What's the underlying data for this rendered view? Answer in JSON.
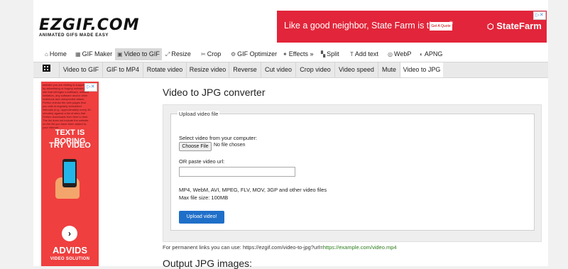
{
  "logo": {
    "main": "EZGIF.COM",
    "tagline": "ANIMATED GIFS MADE EASY"
  },
  "top_ad": {
    "slogan": "Like a good neighbor, State Farm is there.",
    "trademark": "®",
    "button": "Get A Quote",
    "brand": "StateFarm",
    "brand_icon": "state-farm-logo",
    "adchoice": "▷✕",
    "bg": "#e2253a"
  },
  "nav_main": [
    {
      "label": "Home",
      "icon": "⌂"
    },
    {
      "label": "GIF Maker",
      "icon": "▦"
    },
    {
      "label": "Video to GIF",
      "icon": "▣"
    },
    {
      "label": "Resize",
      "icon": "⤢"
    },
    {
      "label": "Crop",
      "icon": "✂"
    },
    {
      "label": "GIF Optimizer",
      "icon": "⚙"
    },
    {
      "label": "Effects »",
      "icon": "✦"
    },
    {
      "label": "Split",
      "icon": "▚"
    },
    {
      "label": "Add text",
      "icon": "T"
    },
    {
      "label": "WebP",
      "icon": "◎"
    },
    {
      "label": "APNG",
      "icon": "◐"
    }
  ],
  "nav_sub": [
    "Video to GIF",
    "GIF to MP4",
    "Rotate video",
    "Resize video",
    "Reverse",
    "Cut video",
    "Crop video",
    "Video speed",
    "Mute",
    "Video to JPG"
  ],
  "side_ad": {
    "blurred_text": "website you are visiting is supported by advertising or forgery website) or a site that infringes a software, without limitation, any software and/or other malicious and unexpected attack, Firefox checks the web pages that you visit at regularly scheduled intervals (e.g., approximately every 30 minutes) against a list of sites that Firefox downloads from time to time. The list does not include the website on the list you have been added to, your internet...",
    "line1": "TEXT IS BORING",
    "line2": "TRY VIDEO",
    "arrow": "›",
    "brand": "ADVIDS",
    "sub": "VIDEO SOLUTION",
    "adchoice": "▷✕"
  },
  "page": {
    "title": "Video to JPG converter",
    "legend": "Upload video file",
    "select_label": "Select video from your computer:",
    "choose_button": "Choose File",
    "no_file": "No file chosen",
    "paste_label": "OR paste video url:",
    "url_value": "",
    "formats": "MP4, WebM, AVI, MPEG, FLV, MOV, 3GP and other video files",
    "max_size": "Max file size: 100MB",
    "upload_button": "Upload video!",
    "perm_text": "For permanent links you can use: https://ezgif.com/video-to-jpg?url=",
    "perm_link": "https://example.com/video.mp4",
    "output_title": "Output JPG images:"
  }
}
